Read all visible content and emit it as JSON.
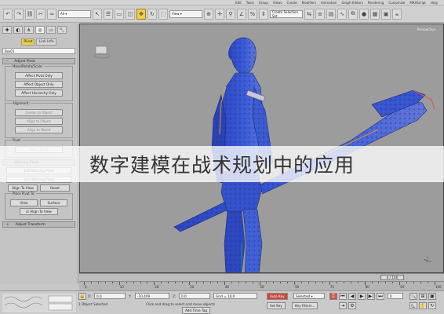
{
  "menubar": {
    "items": [
      "Edit",
      "Tools",
      "Group",
      "Views",
      "Create",
      "Modifiers",
      "Animation",
      "Graph Editors",
      "Rendering",
      "Customize",
      "MAXScript",
      "Help"
    ]
  },
  "toolbar": {
    "selection_set_placeholder": "Create Selection Set",
    "view_dropdown": "View"
  },
  "command_panel": {
    "tabs": [
      "Pivot",
      "Link Info"
    ],
    "object_name": "Box01",
    "adjust_pivot": {
      "header": "Adjust Pivot",
      "move_rotate_group": "Move/Rotate/Scale:",
      "buttons": [
        "Affect Pivot Only",
        "Affect Object Only",
        "Affect Hierarchy Only"
      ],
      "alignment_group": "Alignment:",
      "align_buttons": [
        "Center to Object",
        "Align to Object",
        "Align to World"
      ],
      "pivot_group": "Pivot:",
      "reset_pivot": "Reset Pivot"
    },
    "adjust_working_pivot": {
      "header": "Working Pivot",
      "buttons": [
        "Edit Working Pivot",
        "Use Working Pivot"
      ],
      "row_buttons": [
        "Align To View",
        "Reset"
      ],
      "place_pivot_group": "Place Pivot To:",
      "place_buttons": [
        "View",
        "Surface"
      ],
      "align_to_view": "Align To View"
    },
    "adjust_transform_header": "Adjust Transform"
  },
  "viewport": {
    "label": "Perspective"
  },
  "banner": {
    "text": "数字建模在战术规划中的应用"
  },
  "timeline": {
    "frame_display": "0 / 100",
    "ticks": [
      "0",
      "10",
      "20",
      "30",
      "40",
      "50",
      "60",
      "70",
      "80",
      "90",
      "100"
    ]
  },
  "statusbar": {
    "selected": "1 Object Selected",
    "prompt": "Click and drag to select and move objects",
    "x_label": "X:",
    "x_value": "0.0",
    "y_label": "Y:",
    "y_value": "-10.409",
    "z_label": "Z:",
    "z_value": "0.0",
    "grid": "Grid = 10.0",
    "auto_key": "Auto Key",
    "set_key": "Set Key",
    "key_filters": "Key Filters...",
    "selected_dropdown": "Selected",
    "add_time_tag": "Add Time Tag",
    "frame_value": "0"
  }
}
